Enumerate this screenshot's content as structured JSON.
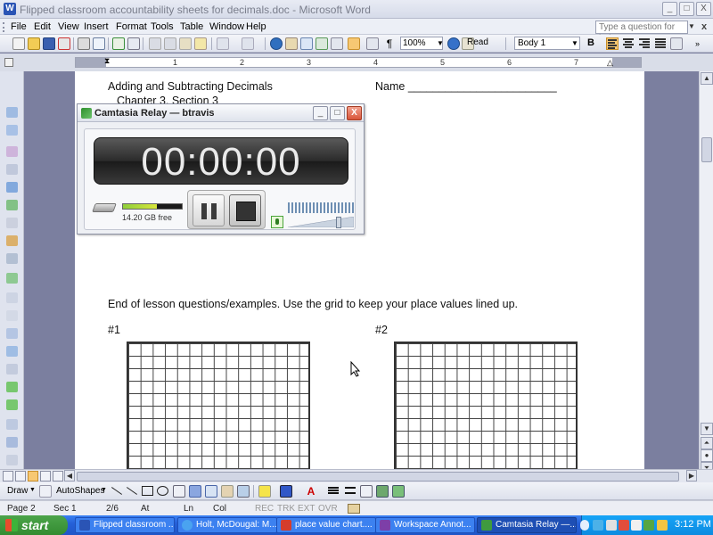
{
  "window": {
    "title": "Flipped classroom accountability sheets for decimals.doc - Microsoft Word",
    "minimize": "_",
    "maximize": "□",
    "close": "X"
  },
  "menu": {
    "items": [
      "File",
      "Edit",
      "View",
      "Insert",
      "Format",
      "Tools",
      "Table",
      "Window",
      "Help"
    ],
    "help_placeholder": "Type a question for help",
    "close_doc": "x"
  },
  "toolbar": {
    "zoom": "100%",
    "read_label": "Read",
    "style": "Body 1",
    "bold": "B"
  },
  "ruler": {
    "numbers": [
      "1",
      "2",
      "3",
      "4",
      "5",
      "6",
      "7"
    ]
  },
  "document": {
    "heading": "Adding and Subtracting Decimals",
    "subheading": "Chapter 3, Section 3",
    "name_label": "Name ________________________",
    "instructions": "End of lesson questions/examples. Use the grid to keep your place values lined up.",
    "problem_1": "#1",
    "problem_2": "#2"
  },
  "camtasia": {
    "title": "Camtasia Relay — btravis",
    "timer": "00:00:00",
    "disk_free": "14.20 GB free",
    "disk_meter_level": 0.57,
    "volume_level": 0.8
  },
  "drawing_toolbar": {
    "draw_label": "Draw",
    "autoshapes_label": "AutoShapes"
  },
  "status": {
    "page": "Page 2",
    "section": "Sec 1",
    "page_of": "2/6",
    "at": "At",
    "ln": "Ln",
    "col": "Col",
    "rec": "REC",
    "trk": "TRK",
    "ext": "EXT",
    "ovr": "OVR"
  },
  "taskbar": {
    "start_label": "start",
    "tasks": [
      "Flipped classroom ...",
      "Holt, McDougal: M...",
      "place value chart....",
      "Workspace Annot...",
      "Camtasia Relay —..."
    ],
    "clock": "3:12 PM"
  },
  "colors": {
    "doc_background": "#7b7f9f",
    "taskbar_blue": "#2560d8",
    "start_green": "#338c31",
    "tray_blue": "#0d8be0",
    "meter_green": "#8fcf3b"
  }
}
